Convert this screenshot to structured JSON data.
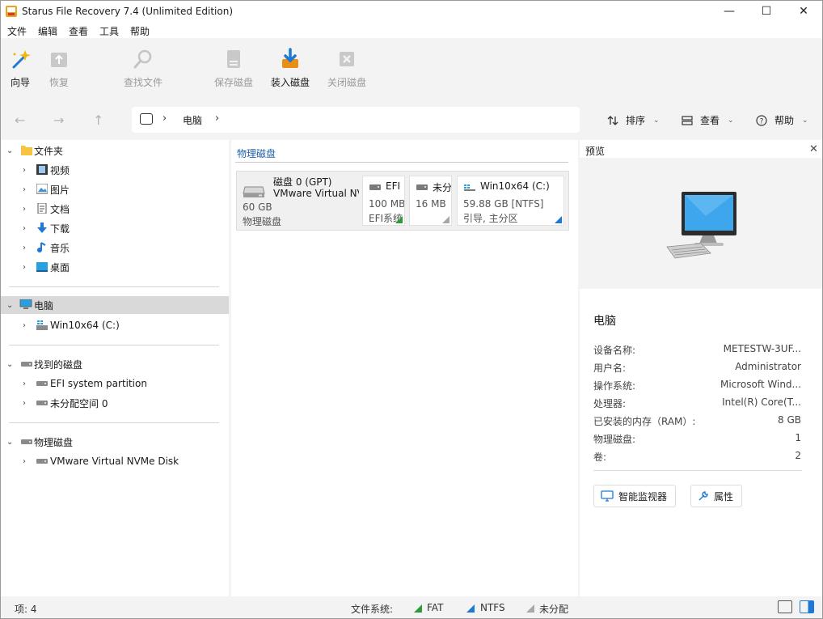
{
  "window": {
    "title": "Starus File Recovery 7.4 (Unlimited Edition)",
    "minimize_glyph": "—",
    "maximize_glyph": "☐",
    "close_glyph": "✕"
  },
  "menu": [
    "文件",
    "编辑",
    "查看",
    "工具",
    "帮助"
  ],
  "toolbar": {
    "wizard": "向导",
    "recover": "恢复",
    "find_file": "查找文件",
    "save_disk": "保存磁盘",
    "mount_disk": "装入磁盘",
    "close_disk": "关闭磁盘"
  },
  "nav": {
    "back_glyph": "←",
    "forward_glyph": "→",
    "up_glyph": "↑",
    "path_sep": "›",
    "path": "电脑",
    "sort": "排序",
    "view": "查看",
    "help": "帮助"
  },
  "tree": {
    "folders_label": "文件夹",
    "folders": [
      "视频",
      "图片",
      "文档",
      "下载",
      "音乐",
      "桌面"
    ],
    "computer_label": "电脑",
    "computer_children": [
      "Win10x64 (C:)"
    ],
    "found_disks_label": "找到的磁盘",
    "found_disks": [
      "EFI system partition",
      "未分配空间 0"
    ],
    "physical_disks_label": "物理磁盘",
    "physical_disks": [
      "VMware Virtual NVMe Disk"
    ]
  },
  "center": {
    "section_title": "物理磁盘",
    "disk": {
      "name": "磁盘 0 (GPT)",
      "model": "VMware Virtual NVMe Disk",
      "size": "60 GB",
      "type": "物理磁盘"
    },
    "partitions": [
      {
        "name": "EFI",
        "size": "100 MB",
        "info": "EFI系统",
        "fs_color": "#2e9a3a"
      },
      {
        "name": "未分",
        "size": "16 MB",
        "info": "",
        "fs_color": "#a8a8a8"
      },
      {
        "name": "Win10x64 (C:)",
        "size": "59.88 GB [NTFS]",
        "info": "引导, 主分区",
        "fs_color": "#1e78d6"
      }
    ]
  },
  "preview": {
    "title": "预览",
    "pc_name": "电脑",
    "properties": [
      {
        "key": "设备名称:",
        "value": "METESTW-3UF..."
      },
      {
        "key": "用户名:",
        "value": "Administrator"
      },
      {
        "key": "操作系统:",
        "value": "Microsoft Wind..."
      },
      {
        "key": "处理器:",
        "value": "Intel(R) Core(T..."
      },
      {
        "key": "已安装的内存（RAM）:",
        "value": "8 GB"
      },
      {
        "key": "物理磁盘:",
        "value": "1"
      },
      {
        "key": "卷:",
        "value": "2"
      }
    ],
    "monitor_button": "智能监视器",
    "properties_button": "属性"
  },
  "status": {
    "items": "项:  4",
    "fs_label": "文件系统:",
    "fat": "FAT",
    "ntfs": "NTFS",
    "unalloc": "未分配"
  },
  "colors": {
    "accent": "#1f5fa8",
    "fat": "#2e9a3a",
    "ntfs": "#1e78d6",
    "unalloc": "#a8a8a8"
  }
}
